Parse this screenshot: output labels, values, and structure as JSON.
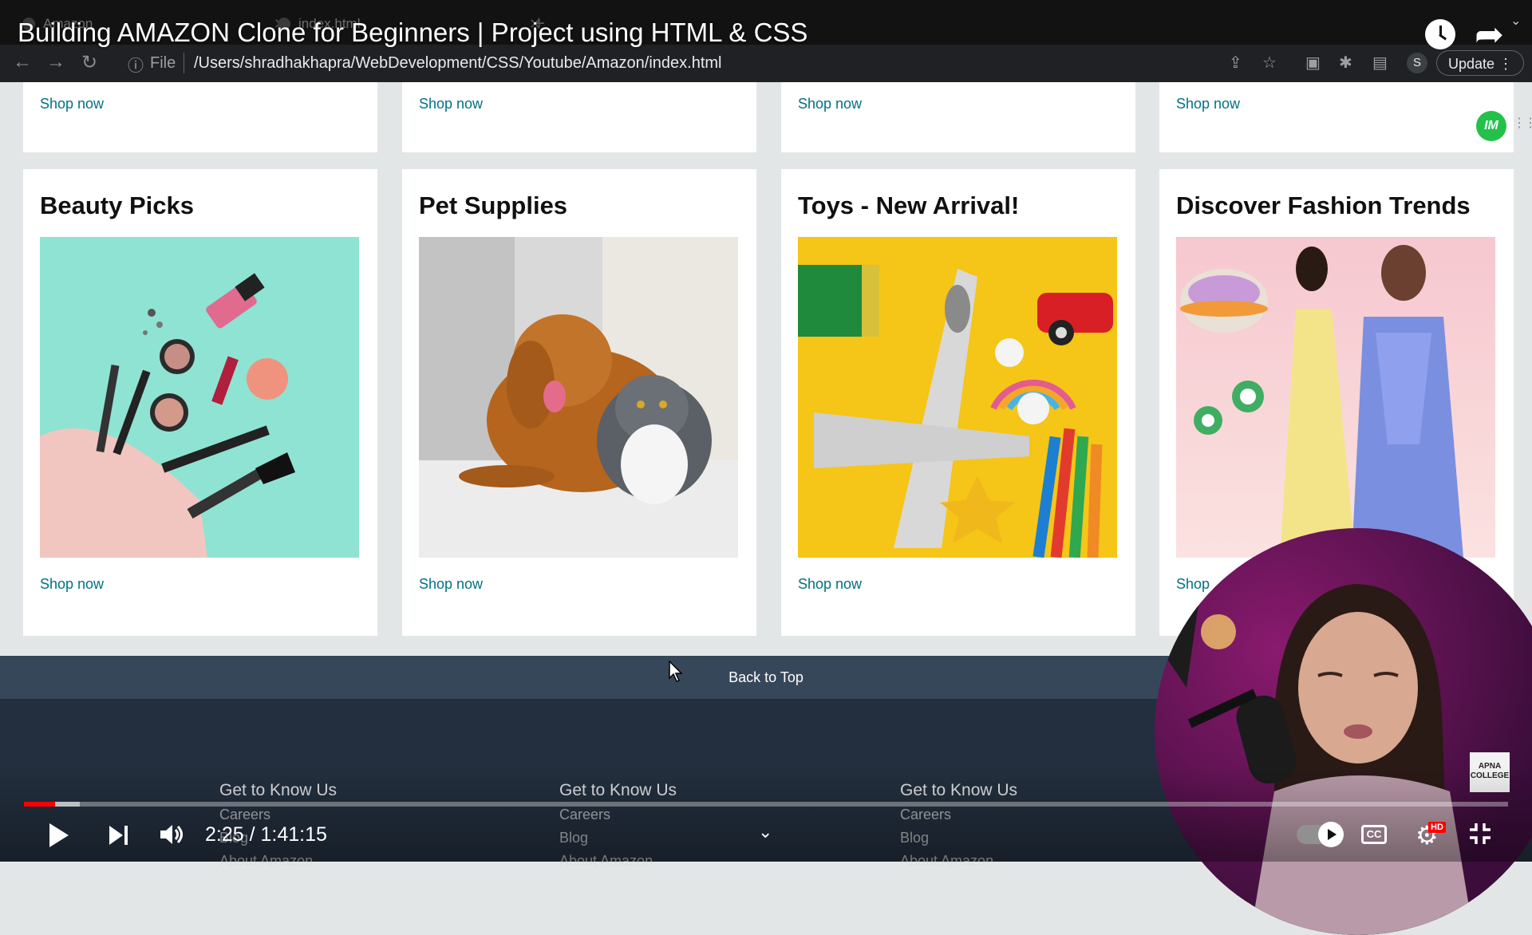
{
  "video": {
    "title": "Building AMAZON Clone for Beginners | Project using HTML & CSS",
    "time_display": "2:25 / 1:41:15",
    "played_fraction": 0.0208,
    "buffered_fraction": 0.0375,
    "hd_label": "HD",
    "cc_label": "CC"
  },
  "browser": {
    "tabs": [
      {
        "label": "Amazon"
      },
      {
        "label": "index.html"
      }
    ],
    "address_label": "File",
    "address_url": "/Users/shradhakhapra/WebDevelopment/CSS/Youtube/Amazon/index.html",
    "profile_initial": "S",
    "update_label": "Update"
  },
  "top_row": {
    "shop_now": [
      "Shop now",
      "Shop now",
      "Shop now",
      "Shop now"
    ]
  },
  "cards": [
    {
      "title": "Beauty Picks",
      "link": "Shop now"
    },
    {
      "title": "Pet Supplies",
      "link": "Shop now"
    },
    {
      "title": "Toys - New Arrival!",
      "link": "Shop now"
    },
    {
      "title": "Discover Fashion Trends",
      "link": "Shop"
    }
  ],
  "back_to_top": "Back to Top",
  "footer": {
    "columns": [
      {
        "heading": "Get to Know Us",
        "links": [
          "Careers",
          "Blog",
          "About Amazon"
        ]
      },
      {
        "heading": "Get to Know Us",
        "links": [
          "Careers",
          "Blog",
          "About Amazon"
        ]
      },
      {
        "heading": "Get to Know Us",
        "links": [
          "Careers",
          "Blog",
          "About Amazon"
        ]
      }
    ]
  },
  "channel_badge": "APNA COLLEGE",
  "extension_badge": "IM",
  "colors": {
    "link": "#007185",
    "back_to_top_bg": "#37475a",
    "footer_bg": "#232f3e",
    "progress": "#ff0000"
  }
}
